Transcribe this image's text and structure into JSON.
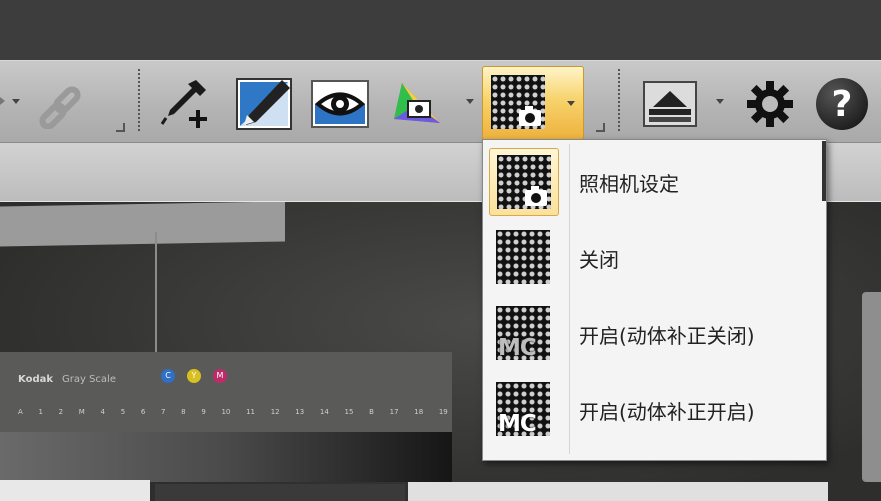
{
  "toolbar": {
    "tools": [
      {
        "name": "link-icon"
      },
      {
        "name": "eyedropper-add-icon"
      },
      {
        "name": "pencil-icon"
      },
      {
        "name": "eye-icon"
      },
      {
        "name": "color-profile-camera-icon"
      },
      {
        "name": "camera-settings-icon"
      },
      {
        "name": "layer-stack-icon"
      },
      {
        "name": "gear-icon"
      },
      {
        "name": "help-icon"
      }
    ],
    "help_glyph": "?"
  },
  "dropdown": {
    "items": [
      {
        "label": "照相机设定",
        "icon": "camera-settings-icon",
        "selected": true
      },
      {
        "label": "关闭",
        "icon": "grid-off-icon",
        "selected": false
      },
      {
        "label": "开启(动体补正关闭)",
        "icon": "mc-off-icon",
        "badge": "MC",
        "selected": false
      },
      {
        "label": "开启(动体补正开启)",
        "icon": "mc-on-icon",
        "badge": "MC",
        "selected": false
      }
    ]
  },
  "canvas": {
    "target_brand": "Kodak",
    "target_name": "Gray Scale",
    "swatches": [
      "C",
      "Y",
      "M"
    ],
    "scale_labels": [
      "A",
      "1",
      "2",
      "M",
      "4",
      "5",
      "6",
      "7",
      "8",
      "9",
      "10",
      "11",
      "12",
      "13",
      "14",
      "15",
      "B",
      "17",
      "18",
      "19"
    ],
    "colors": {
      "cyan": "#2f6fc8",
      "yellow": "#d8c020",
      "magenta": "#c02a6a",
      "accent": "#f0b940"
    }
  }
}
